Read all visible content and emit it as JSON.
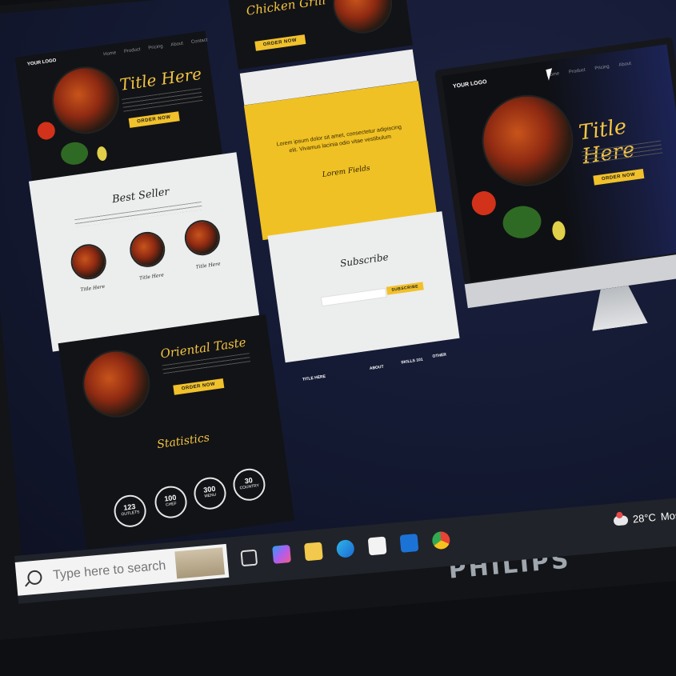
{
  "left_design": {
    "logo": "YOUR LOGO",
    "nav": [
      "Home",
      "Product",
      "Pricing",
      "About",
      "Contact"
    ],
    "hero_title": "Title Here",
    "hero_button": "ORDER NOW",
    "best_seller_title": "Best Seller",
    "items": [
      "Title Here",
      "Title Here",
      "Title Here"
    ],
    "oriental_title": "Oriental Taste",
    "oriental_button": "ORDER NOW",
    "statistics_title": "Statistics",
    "stats": [
      {
        "value": "123",
        "label": "OUTLETS"
      },
      {
        "value": "100",
        "label": "CHEF"
      },
      {
        "value": "300",
        "label": "MENU"
      },
      {
        "value": "30",
        "label": "COUNTRY"
      }
    ]
  },
  "middle_design": {
    "title": "Chicken Grill",
    "button": "ORDER NOW",
    "quote": "Lorem ipsum dolor sit amet, consectetur adipiscing elit. Vivamus lacinia odio vitae vestibulum",
    "author": "Lorem Fields",
    "subscribe_title": "Subscribe",
    "subscribe_button": "SUBSCRIBE",
    "footer": {
      "col1_title": "TITLE HERE",
      "col2_title": "ABOUT",
      "col3_title": "SKILLS 101",
      "col4_title": "OTHER"
    }
  },
  "preview_monitor": {
    "logo": "YOUR LOGO",
    "nav": [
      "Home",
      "Product",
      "Pricing",
      "About"
    ],
    "hero_title": "Title Here",
    "hero_button": "ORDER NOW"
  },
  "taskbar": {
    "search_placeholder": "Type here to search",
    "weather_temp": "28°C",
    "weather_text": "Mostly"
  },
  "monitor_brand": "PHILIPS",
  "colors": {
    "accent": "#f1c12c",
    "screen_bg": "#141a33",
    "taskbar": "#202329"
  },
  "icons": [
    "task-view-icon",
    "copilot-icon",
    "file-explorer-icon",
    "edge-icon",
    "store-icon",
    "outlook-icon",
    "chrome-icon"
  ]
}
